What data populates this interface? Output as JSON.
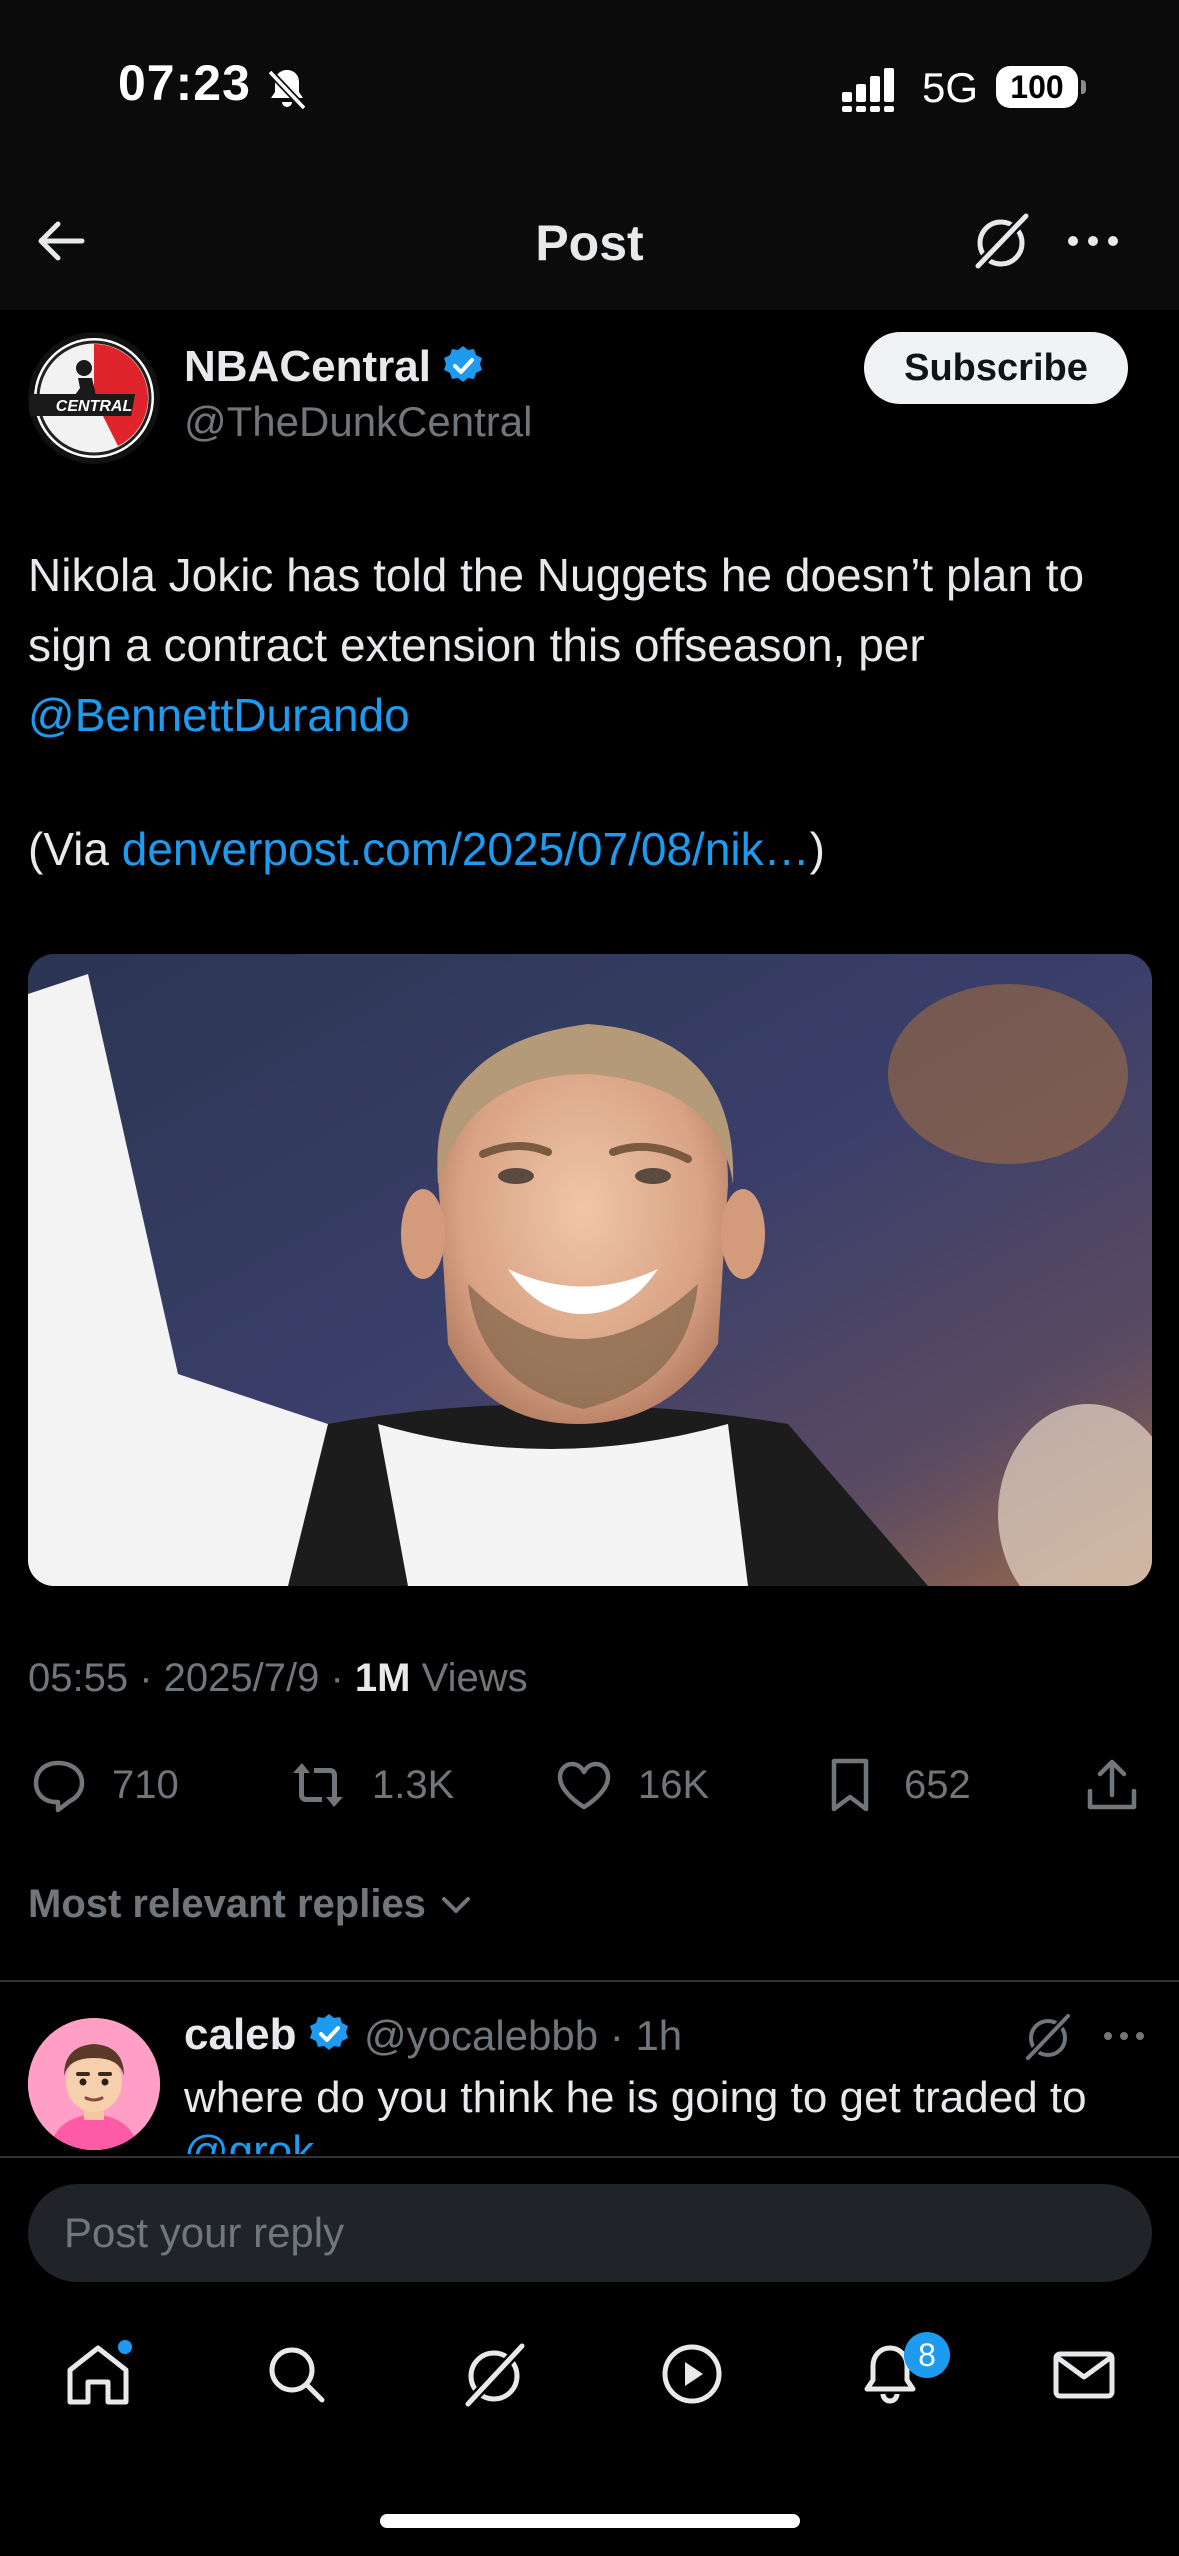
{
  "status_bar": {
    "time": "07:23",
    "network": "5G",
    "battery": "100"
  },
  "header": {
    "title": "Post"
  },
  "post": {
    "author_name": "NBACentral",
    "author_handle": "@TheDunkCentral",
    "avatar_text": "CENTRAL",
    "subscribe_label": "Subscribe",
    "text": "Nikola Jokic has told the Nuggets he doesn’t plan to sign a contract extension this offseason, per",
    "mention": "@BennettDurando",
    "via_prefix": "(Via",
    "via_link": "denverpost.com/2025/07/08/nik…",
    "via_suffix": ")",
    "timestamp": "05:55 · 2025/7/9 · ",
    "views_count": "1M",
    "views_label": "Views",
    "replies": "710",
    "reposts": "1.3K",
    "likes": "16K",
    "bookmarks": "652"
  },
  "replies_section": {
    "sort_label": "Most relevant replies",
    "first_reply": {
      "name": "caleb",
      "handle_time": "@yocalebbb · 1h",
      "text": "where do you think he is going to get traded to",
      "overflow_mention": "@grok"
    }
  },
  "composer": {
    "placeholder": "Post your reply"
  },
  "tab_bar": {
    "notifications_badge": "8"
  },
  "colors": {
    "accent": "#1d9bf0",
    "background": "#000000",
    "muted": "#71767b"
  }
}
